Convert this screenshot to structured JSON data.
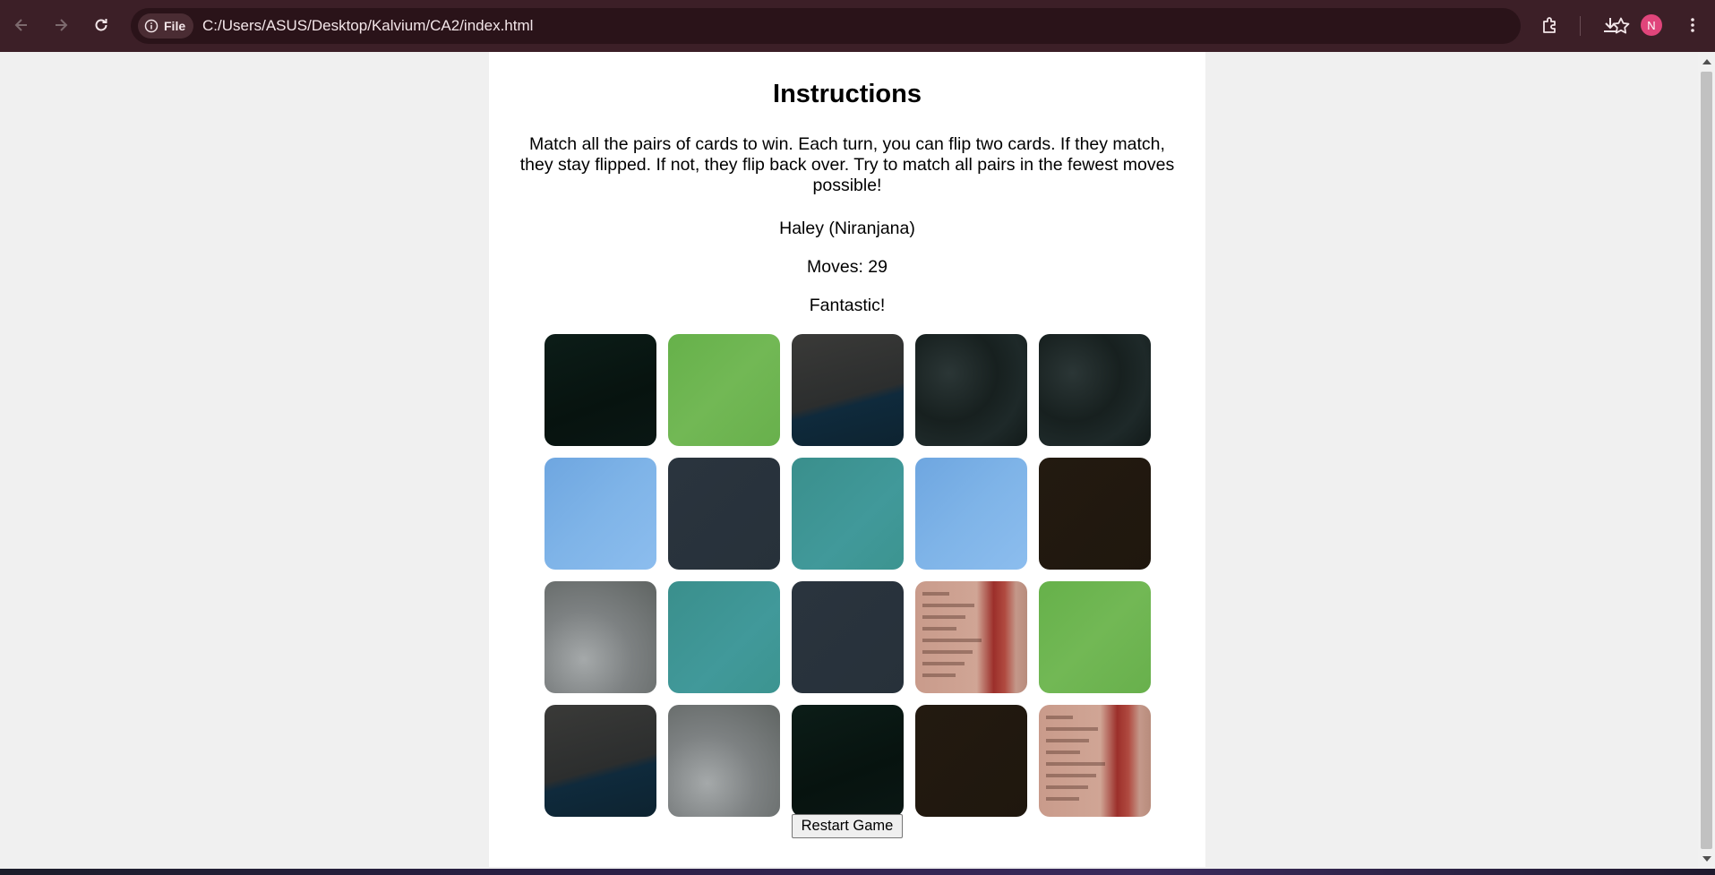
{
  "browser": {
    "site_chip_label": "File",
    "url": "C:/Users/ASUS/Desktop/Kalvium/CA2/index.html",
    "profile_initial": "N",
    "icons": [
      "back-icon",
      "forward-icon",
      "reload-icon",
      "info-icon",
      "star-icon",
      "extensions-icon",
      "download-icon",
      "menu-icon"
    ]
  },
  "page": {
    "title": "Instructions",
    "instructions": "Match all the pairs of cards to win. Each turn, you can flip two cards. If they match, they stay flipped. If not, they flip back over. Try to match all pairs in the fewest moves possible!",
    "player": "Haley (Niranjana)",
    "moves": "Moves: 29",
    "message": "Fantastic!",
    "restart_label": "Restart Game"
  },
  "cards": [
    {
      "image": "dark-forest",
      "fill": "#0a1a15"
    },
    {
      "image": "green-gradient",
      "fill": "#6db34f"
    },
    {
      "image": "dark-horizon",
      "fill": "#2f3233"
    },
    {
      "image": "dark-rock",
      "fill": "#1f2a2a"
    },
    {
      "image": "dark-rock",
      "fill": "#1f2a2a"
    },
    {
      "image": "light-blue",
      "fill": "#7eb2e6"
    },
    {
      "image": "slate",
      "fill": "#28323c"
    },
    {
      "image": "teal",
      "fill": "#3e9693"
    },
    {
      "image": "light-blue",
      "fill": "#7eb2e6"
    },
    {
      "image": "dark-brown",
      "fill": "#241a10"
    },
    {
      "image": "grey-mist",
      "fill": "#8a8e90"
    },
    {
      "image": "teal",
      "fill": "#3e9693"
    },
    {
      "image": "slate",
      "fill": "#28323c"
    },
    {
      "image": "book-page",
      "fill": "#c49684"
    },
    {
      "image": "green-gradient",
      "fill": "#6db34f"
    },
    {
      "image": "dark-horizon",
      "fill": "#2f3233"
    },
    {
      "image": "grey-mist",
      "fill": "#8a8e90"
    },
    {
      "image": "dark-forest",
      "fill": "#0a1a15"
    },
    {
      "image": "dark-brown",
      "fill": "#241a10"
    },
    {
      "image": "book-page",
      "fill": "#c49684"
    }
  ],
  "colors": {
    "chrome": "#3c1f27",
    "omnibox": "#2a1319",
    "page_background": "#f0f0f0",
    "container": "#ffffff",
    "avatar": "#e0457b"
  }
}
